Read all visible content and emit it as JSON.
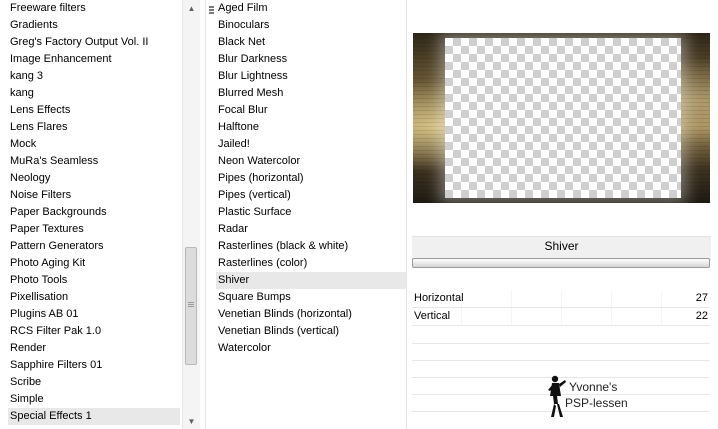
{
  "filters_list": {
    "items": [
      "Freeware filters",
      "Gradients",
      "Greg's Factory Output Vol. II",
      "Image Enhancement",
      "kang 3",
      "kang",
      "Lens Effects",
      "Lens Flares",
      "Mock",
      "MuRa's Seamless",
      "Neology",
      "Noise Filters",
      "Paper Backgrounds",
      "Paper Textures",
      "Pattern Generators",
      "Photo Aging Kit",
      "Photo Tools",
      "Pixellisation",
      "Plugins AB 01",
      "RCS Filter Pak 1.0",
      "Render",
      "Sapphire Filters 01",
      "Scribe",
      "Simple",
      "Special Effects 1"
    ],
    "selected": "Special Effects 1"
  },
  "effects_list": {
    "items": [
      "Aged Film",
      "Binoculars",
      "Black Net",
      "Blur Darkness",
      "Blur Lightness",
      "Blurred Mesh",
      "Focal Blur",
      "Halftone",
      "Jailed!",
      "Neon Watercolor",
      "Pipes (horizontal)",
      "Pipes (vertical)",
      "Plastic Surface",
      "Radar",
      "Rasterlines (black & white)",
      "Rasterlines (color)",
      "Shiver",
      "Square Bumps",
      "Venetian Blinds (horizontal)",
      "Venetian Blinds (vertical)",
      "Watercolor"
    ],
    "selected": "Shiver"
  },
  "settings": {
    "effect_name": "Shiver",
    "params": [
      {
        "label": "Horizontal",
        "value": "27"
      },
      {
        "label": "Vertical",
        "value": "22"
      }
    ]
  },
  "watermark": {
    "line1": "Yvonne's",
    "line2": "PSP-lessen"
  },
  "icons": {
    "scroll_up": "arrow-up-icon",
    "scroll_down": "arrow-down-icon",
    "grip": "grip-icon",
    "figure": "dancer-figure-icon"
  },
  "colors": {
    "selection": "#e8e8e8",
    "panel": "#f0f0f0"
  }
}
